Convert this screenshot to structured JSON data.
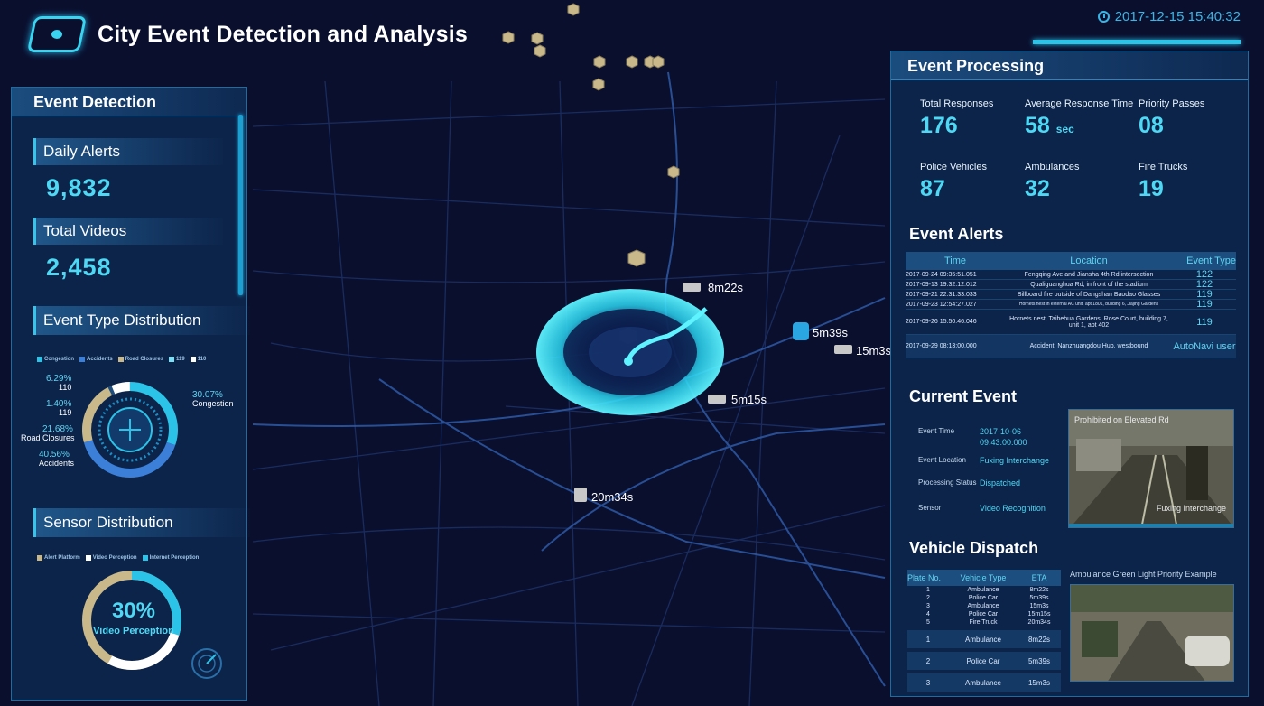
{
  "header": {
    "title": "City Event Detection and Analysis",
    "datetime": "2017-12-15 15:40:32"
  },
  "event_detection": {
    "title": "Event Detection",
    "daily_alerts_label": "Daily Alerts",
    "daily_alerts_value": "9,832",
    "total_videos_label": "Total Videos",
    "total_videos_value": "2,458"
  },
  "event_type_distribution": {
    "title": "Event Type Distribution",
    "legend": [
      "Congestion",
      "Accidents",
      "Road Closures",
      "119",
      "110"
    ],
    "slices": [
      {
        "label": "Congestion",
        "pct": "30.07%",
        "value": 30.07
      },
      {
        "label": "Accidents",
        "pct": "40.56%",
        "value": 40.56
      },
      {
        "label": "Road Closures",
        "pct": "21.68%",
        "value": 21.68
      },
      {
        "label": "119",
        "pct": "1.40%",
        "value": 1.4
      },
      {
        "label": "110",
        "pct": "6.29%",
        "value": 6.29
      }
    ]
  },
  "sensor_distribution": {
    "title": "Sensor Distribution",
    "legend": [
      "Alert Platform",
      "Video Perception",
      "Internet Perception"
    ],
    "percent": "30%",
    "label": "Video Perception"
  },
  "event_processing": {
    "title": "Event Processing",
    "stats": [
      {
        "label": "Total Responses",
        "value": "176",
        "unit": ""
      },
      {
        "label": "Average Response Time",
        "value": "58",
        "unit": "sec"
      },
      {
        "label": "Priority Passes",
        "value": "08",
        "unit": ""
      },
      {
        "label": "Police Vehicles",
        "value": "87",
        "unit": ""
      },
      {
        "label": "Ambulances",
        "value": "32",
        "unit": ""
      },
      {
        "label": "Fire Trucks",
        "value": "19",
        "unit": ""
      }
    ]
  },
  "event_alerts": {
    "title": "Event Alerts",
    "columns": [
      "Time",
      "Location",
      "Event Type"
    ],
    "rows": [
      {
        "time": "2017-09-24 09:35:51.051",
        "location": "Fengqing Ave and Jiansha 4th Rd intersection",
        "type": "122"
      },
      {
        "time": "2017-09-13 19:32:12.012",
        "location": "Qualiguanghua Rd, in front of the stadium",
        "type": "122"
      },
      {
        "time": "2017-09-21 22:31:33.033",
        "location": "Billboard fire outside of Dangshan Baodao Glasses",
        "type": "119"
      },
      {
        "time": "2017-09-23 12:54:27.027",
        "location": "Hornets nest in external AC unit, apt 1801, building 6, Jiajing Gardens",
        "type": "119"
      },
      {
        "time": "2017-09-26 15:50:46.046",
        "location": "Hornets nest, Taihehua Gardens, Rose Court, building 7, unit 1, apt 402",
        "type": "119"
      },
      {
        "time": "2017-09-29 08:13:00.000",
        "location": "Accident, Nanzhuangdou Hub, westbound",
        "type": "AutoNavi user"
      }
    ]
  },
  "current_event": {
    "title": "Current Event",
    "time_label": "Event Time",
    "time_value_1": "2017-10-06",
    "time_value_2": "09:43:00.000",
    "location_label": "Event Location",
    "location_value": "Fuxing Interchange",
    "status_label": "Processing Status",
    "status_value": "Dispatched",
    "sensor_label": "Sensor",
    "sensor_value": "Video Recognition",
    "photo_caption_top": "Prohibited on Elevated Rd",
    "photo_caption_bottom": "Fuxing Interchange"
  },
  "vehicle_dispatch": {
    "title": "Vehicle Dispatch",
    "columns": [
      "Plate No.",
      "Vehicle Type",
      "ETA"
    ],
    "rows_small": [
      {
        "no": "1",
        "type": "Ambulance",
        "eta": "8m22s"
      },
      {
        "no": "2",
        "type": "Police Car",
        "eta": "5m39s"
      },
      {
        "no": "3",
        "type": "Ambulance",
        "eta": "15m3s"
      },
      {
        "no": "4",
        "type": "Police Car",
        "eta": "15m15s"
      },
      {
        "no": "5",
        "type": "Fire Truck",
        "eta": "20m34s"
      }
    ],
    "rows_big": [
      {
        "no": "1",
        "type": "Ambulance",
        "eta": "8m22s"
      },
      {
        "no": "2",
        "type": "Police Car",
        "eta": "5m39s"
      },
      {
        "no": "3",
        "type": "Ambulance",
        "eta": "15m3s"
      }
    ],
    "photo_caption": "Ambulance Green Light Priority Example"
  },
  "map_etas": [
    "8m22s",
    "5m39s",
    "15m3s",
    "5m15s",
    "20m34s"
  ],
  "colors": {
    "accent": "#4fd8f4",
    "background": "#0a0f2e",
    "panel": "#0d2a52",
    "hazard": "#c8b88a"
  }
}
